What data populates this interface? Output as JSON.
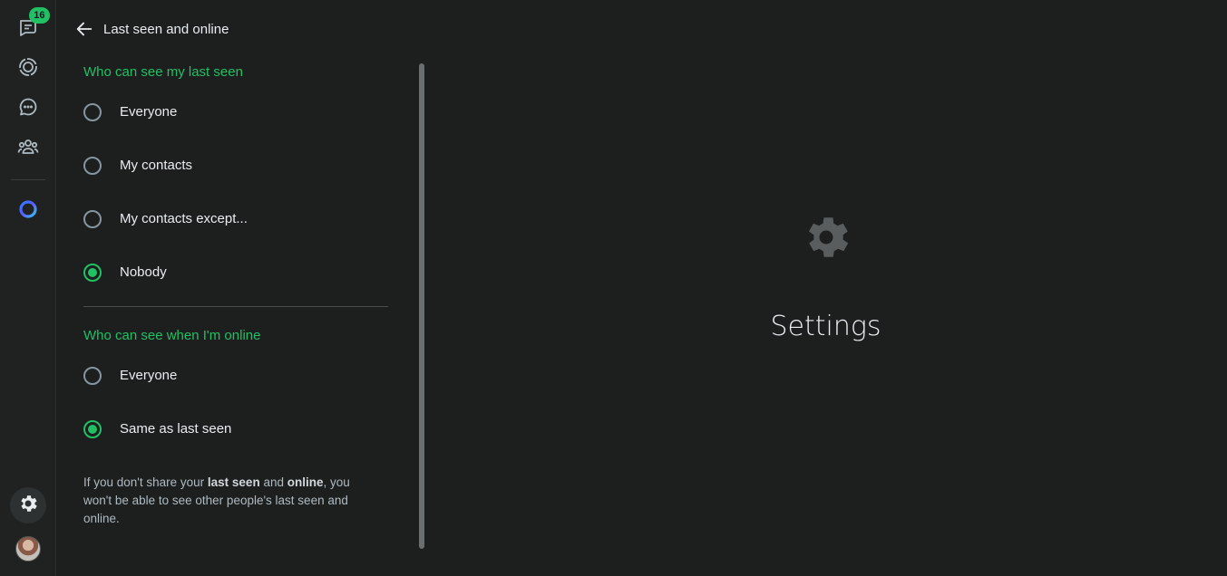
{
  "rail": {
    "chats_badge": "16",
    "items": [
      {
        "name": "chats",
        "icon": "chats-icon"
      },
      {
        "name": "status",
        "icon": "status-icon"
      },
      {
        "name": "channels",
        "icon": "channels-icon"
      },
      {
        "name": "communities",
        "icon": "communities-icon"
      },
      {
        "name": "meta-ai",
        "icon": "meta-ai-icon"
      }
    ],
    "bottom": [
      {
        "name": "settings",
        "icon": "gear-icon"
      },
      {
        "name": "profile",
        "icon": "avatar"
      }
    ]
  },
  "panel": {
    "title": "Last seen and online",
    "last_seen": {
      "title": "Who can see my last seen",
      "options": [
        "Everyone",
        "My contacts",
        "My contacts except...",
        "Nobody"
      ],
      "selected": "Nobody"
    },
    "online": {
      "title": "Who can see when I'm online",
      "options": [
        "Everyone",
        "Same as last seen"
      ],
      "selected": "Same as last seen"
    },
    "note": {
      "part1": "If you don't share your ",
      "bold1": "last seen",
      "part2": " and ",
      "bold2": "online",
      "part3": ", you won't be able to see other people's last seen and online."
    }
  },
  "main": {
    "title": "Settings",
    "icon": "gear-icon"
  },
  "colors": {
    "accent": "#21c063",
    "background": "#1d1f1f",
    "rail": "#202222",
    "text": "#e9edef",
    "muted": "#aebac1"
  }
}
